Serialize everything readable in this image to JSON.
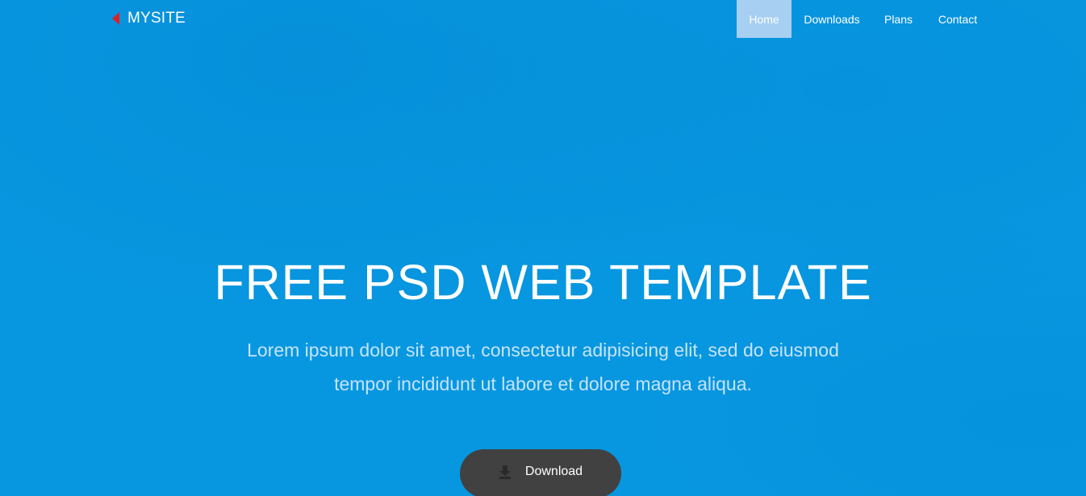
{
  "brand": {
    "label": "MYSITE",
    "icon": "red-left-triangle-icon",
    "icon_color": "#d9232a"
  },
  "nav": {
    "items": [
      {
        "label": "Home",
        "active": true
      },
      {
        "label": "Downloads",
        "active": false
      },
      {
        "label": "Plans",
        "active": false
      },
      {
        "label": "Contact",
        "active": false
      }
    ]
  },
  "hero": {
    "headline": "FREE PSD WEB TEMPLATE",
    "tagline": "Lorem ipsum dolor sit amet, consectetur adipisicing elit, sed do eiusmod tempor incididunt ut labore et dolore magna aliqua.",
    "cta": {
      "label": "Download",
      "icon": "download-icon"
    }
  },
  "colors": {
    "background": "#0797e0",
    "nav_active_bg": "#a7cff1",
    "button_bg": "#414141",
    "tagline": "#c6e4f8"
  }
}
